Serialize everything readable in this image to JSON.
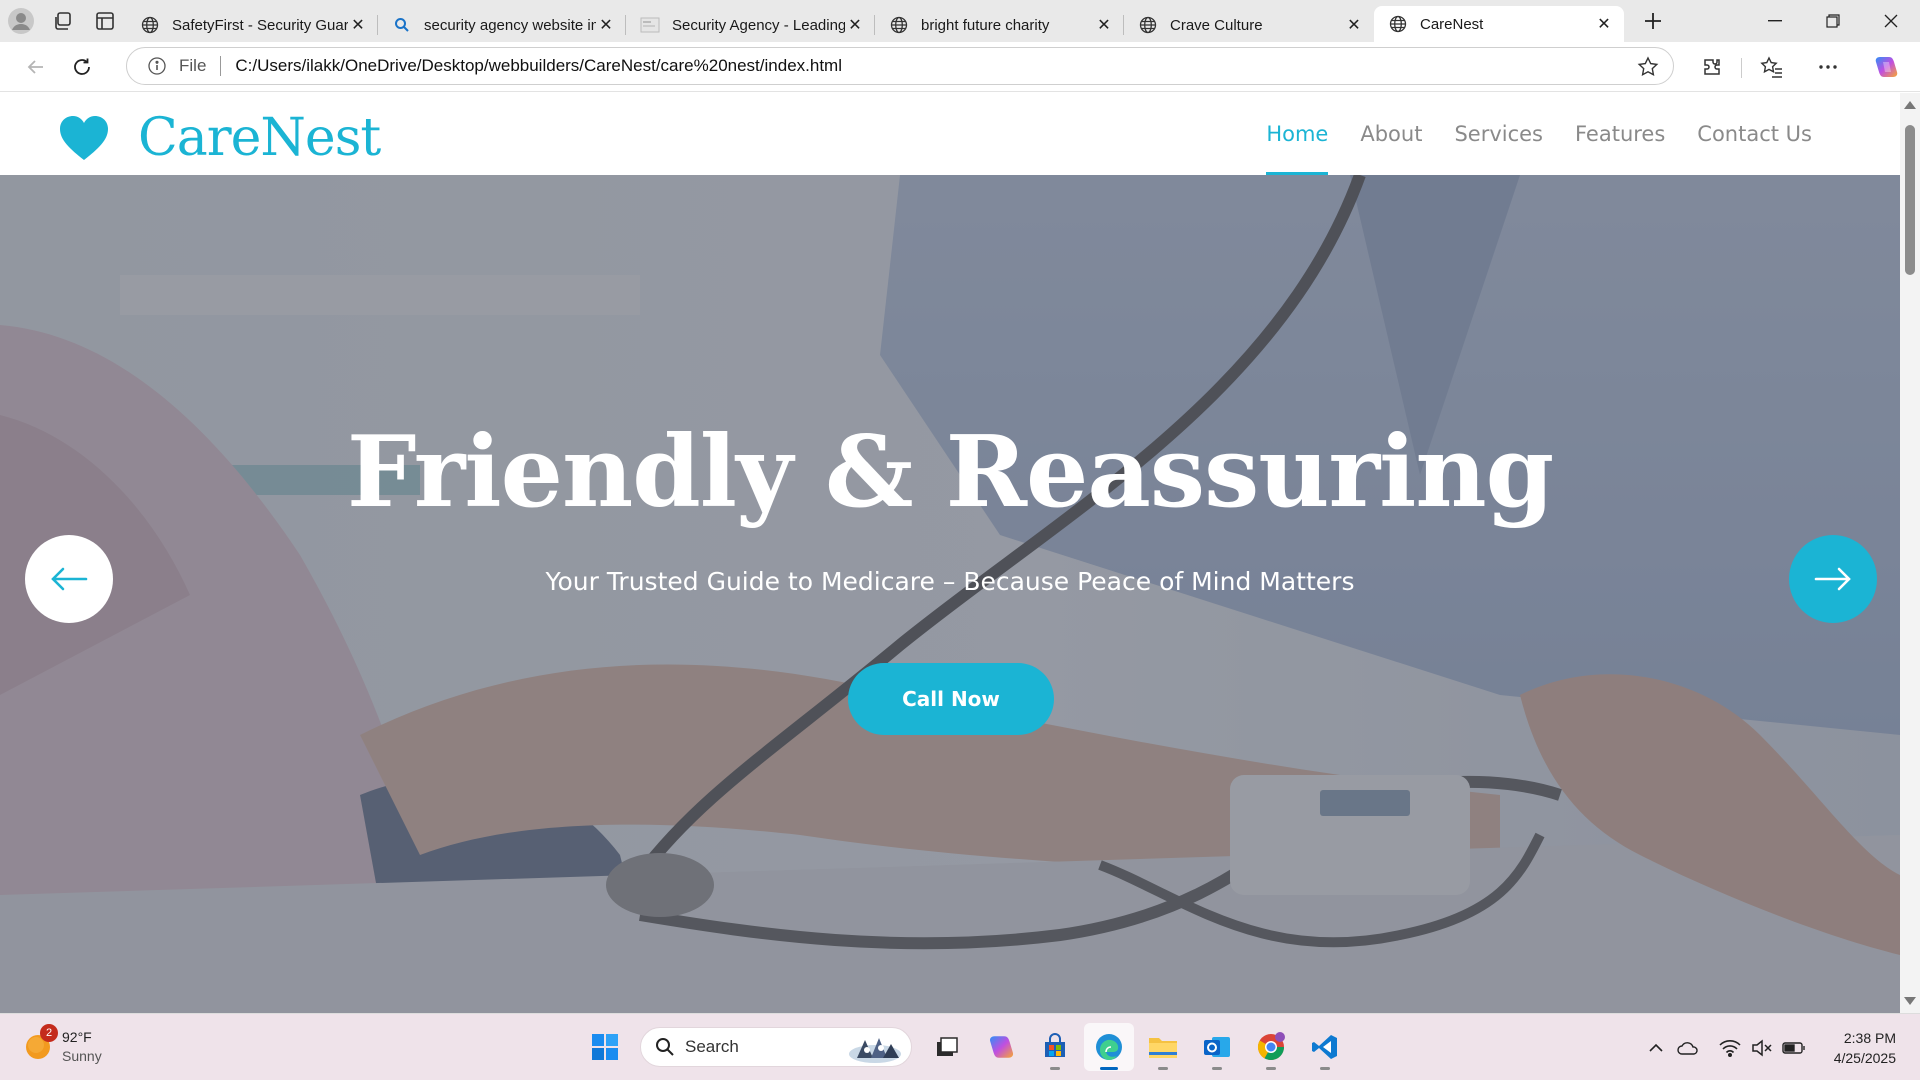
{
  "browser": {
    "tabs": [
      {
        "title": "SafetyFirst - Security Guard",
        "icon": "globe-icon"
      },
      {
        "title": "security agency website images",
        "icon": "search-icon"
      },
      {
        "title": "Security Agency - Leading",
        "icon": "page-thumbnail-icon"
      },
      {
        "title": "bright future charity",
        "icon": "globe-icon"
      },
      {
        "title": "Crave Culture",
        "icon": "globe-icon"
      },
      {
        "title": "CareNest",
        "icon": "globe-icon",
        "active": true
      }
    ],
    "address": {
      "scheme_label": "File",
      "url": "C:/Users/ilakk/OneDrive/Desktop/webbuilders/CareNest/care%20nest/index.html"
    }
  },
  "site": {
    "brand": "CareNest",
    "nav": [
      "Home",
      "About",
      "Services",
      "Features",
      "Contact Us"
    ],
    "active_nav": "Home",
    "hero": {
      "title": "Friendly & Reassuring",
      "subtitle": "Your Trusted Guide to Medicare – Because Peace of Mind Matters",
      "cta": "Call Now"
    },
    "accent_color": "#1bb4d4"
  },
  "taskbar": {
    "weather": {
      "temp": "92°F",
      "condition": "Sunny",
      "badge": "2"
    },
    "search_label": "Search",
    "clock": {
      "time": "2:38 PM",
      "date": "4/25/2025"
    }
  }
}
